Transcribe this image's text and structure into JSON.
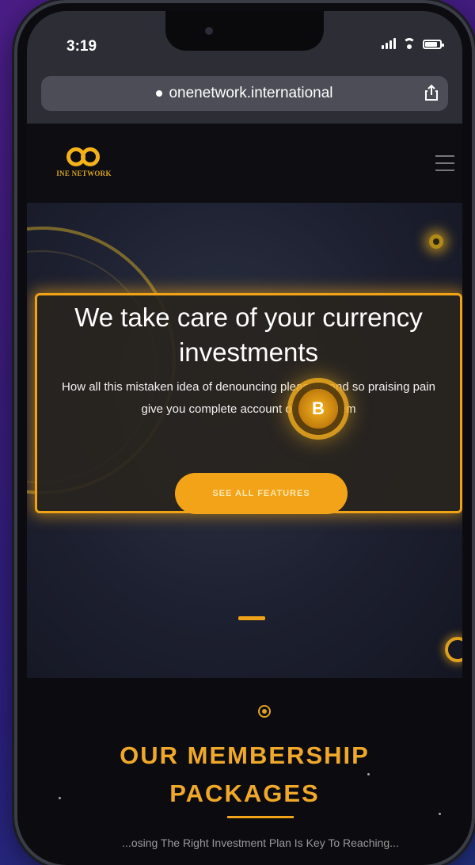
{
  "status_bar": {
    "time": "3:19"
  },
  "browser": {
    "url": "onenetwork.international"
  },
  "site": {
    "logo_text": "INE NETWORK"
  },
  "hero": {
    "title": "We take care of your currency investments",
    "description": "How all this mistaken idea of denouncing pleasure and so praising pain give you complete account of the system",
    "cta_label": "SEE ALL FEATURES",
    "coin_symbol": "B"
  },
  "packages": {
    "title": "OUR MEMBERSHIP PACKAGES",
    "subtitle": "...osing The Right Investment Plan Is Key To Reaching..."
  },
  "colors": {
    "accent": "#f0a316",
    "background": "#16171f"
  }
}
